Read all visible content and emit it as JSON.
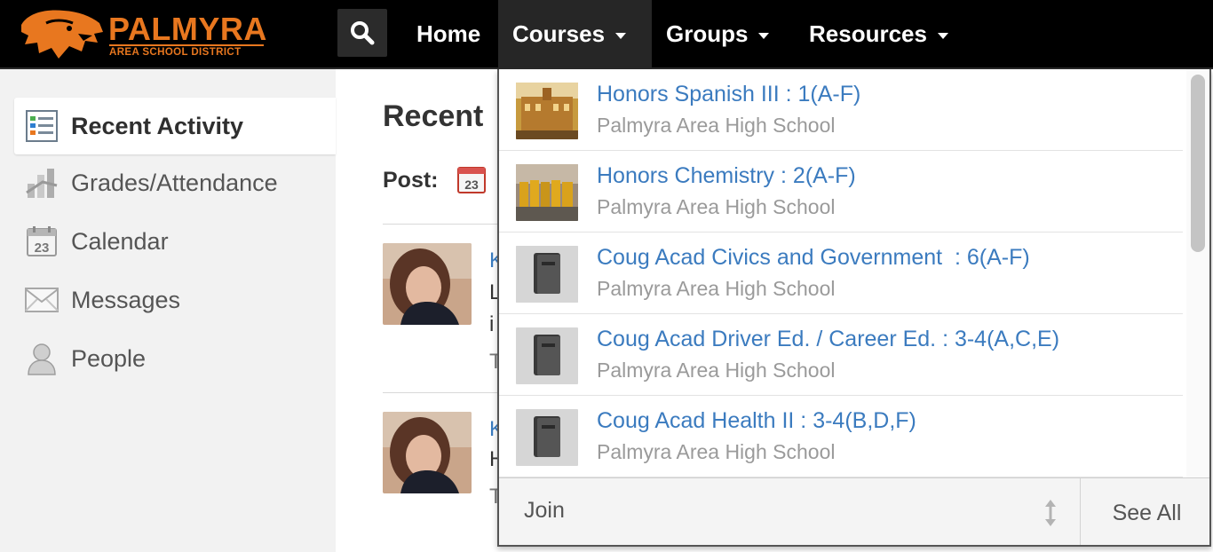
{
  "header": {
    "logo": {
      "name": "PALMYRA",
      "subtitle": "AREA SCHOOL DISTRICT"
    },
    "nav": {
      "home": "Home",
      "courses": "Courses",
      "groups": "Groups",
      "resources": "Resources"
    }
  },
  "sidebar": {
    "items": [
      {
        "label": "Recent Activity",
        "icon": "recent-activity-icon",
        "active": true
      },
      {
        "label": "Grades/Attendance",
        "icon": "grades-icon"
      },
      {
        "label": "Calendar",
        "icon": "calendar-icon"
      },
      {
        "label": "Messages",
        "icon": "envelope-icon"
      },
      {
        "label": "People",
        "icon": "person-icon"
      }
    ]
  },
  "main": {
    "title": "Recent",
    "post_label": "Post:",
    "post_calendar_day": "23",
    "feed_fragments": [
      "K",
      "L",
      "i",
      "T",
      "K",
      "H",
      "T"
    ]
  },
  "courses_dropdown": {
    "items": [
      {
        "title": "Honors Spanish III : 1(A-F)",
        "school": "Palmyra Area High School",
        "thumb": "photo-building"
      },
      {
        "title": "Honors Chemistry : 2(A-F)",
        "school": "Palmyra Area High School",
        "thumb": "photo-group"
      },
      {
        "title": "Coug Acad Civics and Government  : 6(A-F)",
        "school": "Palmyra Area High School",
        "thumb": "book-icon"
      },
      {
        "title": "Coug Acad Driver Ed. / Career Ed. : 3-4(A,C,E)",
        "school": "Palmyra Area High School",
        "thumb": "book-icon"
      },
      {
        "title": "Coug Acad Health II : 3-4(B,D,F)",
        "school": "Palmyra Area High School",
        "thumb": "book-icon"
      }
    ],
    "footer": {
      "join": "Join",
      "see_all": "See All"
    }
  },
  "colors": {
    "brand_orange": "#e8771f",
    "link_blue": "#3b7bbf",
    "nav_bg": "#000000"
  }
}
